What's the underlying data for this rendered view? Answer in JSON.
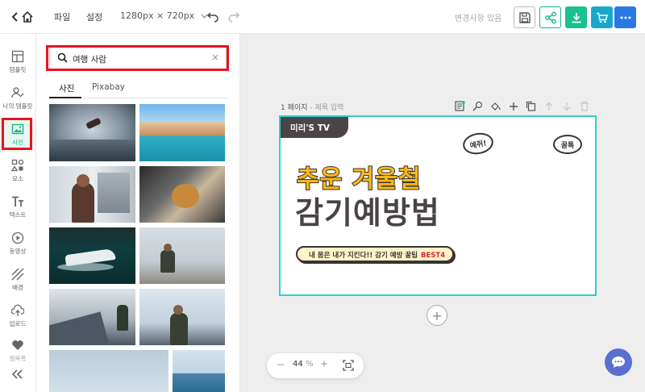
{
  "header": {
    "menu_file": "파일",
    "menu_settings": "설정",
    "canvas_size": "1280px × 720px",
    "save_status": "변경사항 있음"
  },
  "leftnav": {
    "items": [
      {
        "label": "템플릿",
        "icon": "template-icon"
      },
      {
        "label": "나의 템플릿",
        "icon": "my-template-icon"
      },
      {
        "label": "사진",
        "icon": "photo-icon",
        "active": true
      },
      {
        "label": "요소",
        "icon": "elements-icon"
      },
      {
        "label": "텍스트",
        "icon": "text-icon"
      },
      {
        "label": "동영상",
        "icon": "video-icon"
      },
      {
        "label": "배경",
        "icon": "background-icon"
      },
      {
        "label": "업로드",
        "icon": "upload-icon"
      },
      {
        "label": "찜목록",
        "icon": "heart-icon"
      }
    ]
  },
  "panel": {
    "search_value": "여행 사람",
    "tabs": [
      "사진",
      "Pixabay"
    ]
  },
  "canvas": {
    "page_label": "1 페이지",
    "page_sub": "- 제목 입력",
    "zoom_value": "44",
    "zoom_unit": "%"
  },
  "design": {
    "badge": "미리'S TV",
    "title1": "추운 겨울철",
    "title2": "감기예방법",
    "pill_text": "내 몸은 내가 지킨다!! 감기 예방 꿀팁",
    "pill_best": "BEST4",
    "bubble1": "예쥐!",
    "bubble2": "꿀톡"
  },
  "colors": {
    "accent_green": "#19c18f",
    "accent_teal": "#17a8cc",
    "accent_blue": "#2a78e4",
    "highlight_red": "#e8141b",
    "canvas_border": "#2dcfcf"
  }
}
